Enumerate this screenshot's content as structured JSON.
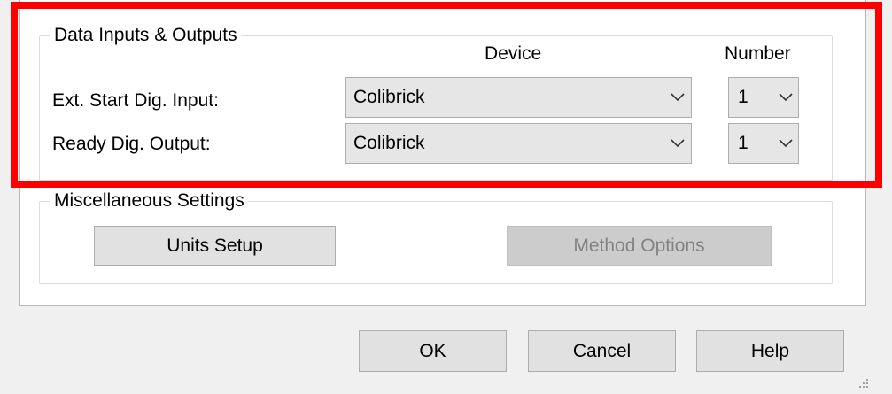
{
  "data_io": {
    "title": "Data Inputs & Outputs",
    "device_header": "Device",
    "number_header": "Number",
    "rows": [
      {
        "label": "Ext. Start Dig. Input:",
        "device": "Colibrick",
        "number": "1"
      },
      {
        "label": "Ready Dig. Output:",
        "device": "Colibrick",
        "number": "1"
      }
    ]
  },
  "misc": {
    "title": "Miscellaneous Settings",
    "units_setup_label": "Units Setup",
    "method_options_label": "Method Options"
  },
  "dialog_buttons": {
    "ok_label": "OK",
    "cancel_label": "Cancel",
    "help_label": "Help"
  },
  "icons": {
    "combo_arrow": "chevron-down-icon",
    "resize": "size-grip-icon"
  },
  "colors": {
    "highlight": "#ff0000",
    "panel_bg": "#ffffff",
    "window_bg": "#f0f0f0"
  }
}
